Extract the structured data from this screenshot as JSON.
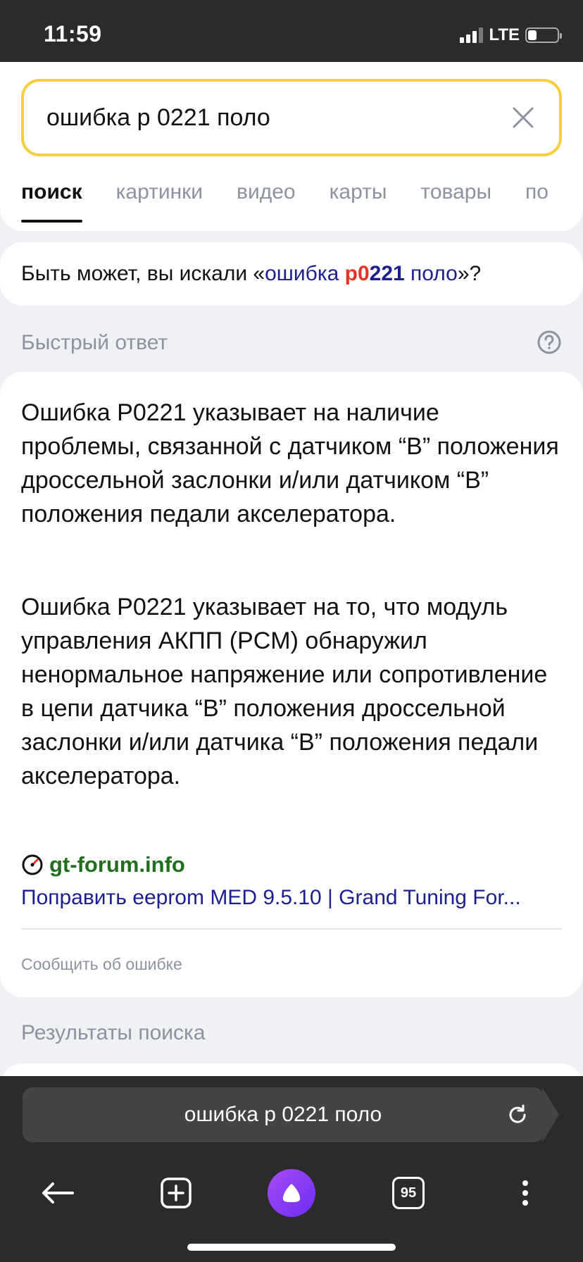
{
  "status": {
    "time": "11:59",
    "network": "LTE"
  },
  "search": {
    "query": "ошибка р 0221 поло"
  },
  "tabs": [
    {
      "label": "поиск"
    },
    {
      "label": "картинки"
    },
    {
      "label": "видео"
    },
    {
      "label": "карты"
    },
    {
      "label": "товары"
    },
    {
      "label": "по"
    }
  ],
  "suggest": {
    "prefix": "Быть может, вы искали «",
    "word1": "ошибка ",
    "red": "р0",
    "bold": "221",
    "word2": " поло",
    "suffix": "»?"
  },
  "quick_answer": {
    "heading": "Быстрый ответ",
    "paragraphs": [
      "Ошибка P0221 указывает на наличие проблемы, связанной с датчиком “B” положения дроссельной заслонки и/или датчиком “B” положения педали акселератора.",
      "Ошибка P0221 указывает на то, что модуль управления АКПП (PCM) обнаружил ненормальное напряжение или сопротивление в цепи датчика “B” положения дроссельной заслонки и/или датчика “B” положения педали акселератора."
    ],
    "source_name": "gt-forum.info",
    "source_title": "Поправить eeprom MED 9.5.10 | Grand Tuning For...",
    "report_label": "Сообщить об ошибке"
  },
  "results_heading": "Результаты поиска",
  "bottom_bar": {
    "url_text": "ошибка р 0221 поло",
    "tabs_count": "95"
  }
}
